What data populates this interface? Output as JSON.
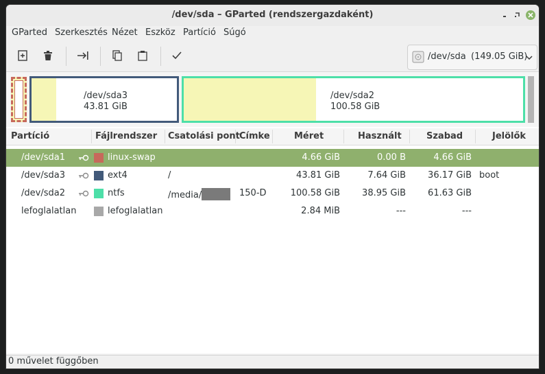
{
  "window": {
    "title": "/dev/sda – GParted (rendszergazdaként)",
    "controls": [
      "minimize",
      "maximize",
      "close"
    ]
  },
  "menu": {
    "items": [
      "GParted",
      "Szerkesztés",
      "Nézet",
      "Eszköz",
      "Partíció",
      "Súgó"
    ]
  },
  "toolbar": {
    "buttons": [
      {
        "name": "new-partition",
        "icon": "new-icon"
      },
      {
        "name": "delete",
        "icon": "trash-icon"
      },
      {
        "name": "resize-move",
        "icon": "resize-icon"
      },
      {
        "name": "copy",
        "icon": "copy-icon"
      },
      {
        "name": "paste",
        "icon": "paste-icon"
      },
      {
        "name": "apply",
        "icon": "checkmark-icon"
      }
    ],
    "device": {
      "name": "/dev/sda",
      "size": "(149.05 GiB)"
    }
  },
  "diskmap": {
    "sda3": {
      "name": "/dev/sda3",
      "size": "43.81 GiB",
      "used_fraction": 0.17,
      "color": "#425a7a"
    },
    "sda2": {
      "name": "/dev/sda2",
      "size": "100.58 GiB",
      "used_fraction": 0.39,
      "color": "#4ddfa8"
    },
    "swap": {
      "color": "#c7695b"
    }
  },
  "table": {
    "headers": [
      "Partíció",
      "Fájlrendszer",
      "Csatolási pont",
      "Címke",
      "Méret",
      "Használt",
      "Szabad",
      "Jelölők"
    ],
    "rows": [
      {
        "partition": "/dev/sda1",
        "fs": "linux-swap",
        "fs_color": "#c7695b",
        "mount": "",
        "label": "",
        "size": "4.66 GiB",
        "used": "0.00 B",
        "free": "4.66 GiB",
        "flags": "",
        "selected": true
      },
      {
        "partition": "/dev/sda3",
        "fs": "ext4",
        "fs_color": "#425a7a",
        "mount": "/",
        "label": "",
        "size": "43.81 GiB",
        "used": "7.64 GiB",
        "free": "36.17 GiB",
        "flags": "boot",
        "selected": false
      },
      {
        "partition": "/dev/sda2",
        "fs": "ntfs",
        "fs_color": "#4ddfa8",
        "mount": "/media/",
        "label": "150-D",
        "size": "100.58 GiB",
        "used": "38.95 GiB",
        "free": "61.63 GiB",
        "flags": "",
        "selected": false
      },
      {
        "partition": "lefoglalatlan",
        "fs": "lefoglalatlan",
        "fs_color": "#a8a8a8",
        "mount": "",
        "label": "",
        "size": "2.84 MiB",
        "used": "---",
        "free": "---",
        "flags": "",
        "selected": false
      }
    ]
  },
  "status": {
    "text": "0 művelet függőben"
  }
}
